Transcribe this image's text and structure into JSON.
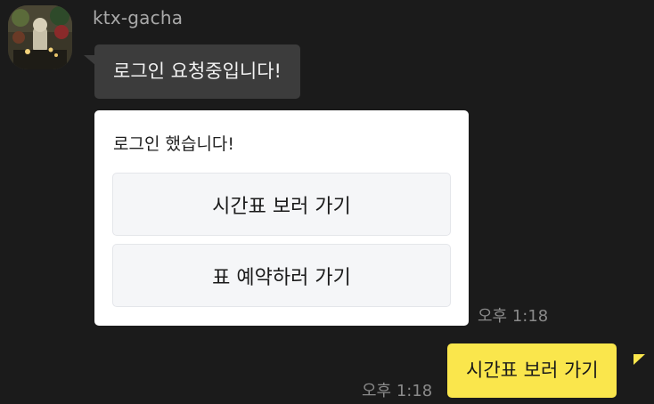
{
  "sender": {
    "name": "ktx-gacha",
    "avatar_icon": "profile-photo-avatar"
  },
  "incoming_message": {
    "text": "로그인 요청중입니다!"
  },
  "card": {
    "text": "로그인 했습니다!",
    "buttons": [
      {
        "label": "시간표 보러 가기"
      },
      {
        "label": "표 예약하러 가기"
      }
    ],
    "time": "오후 1:18"
  },
  "outgoing_message": {
    "text": "시간표 보러 가기",
    "time": "오후 1:18"
  },
  "colors": {
    "background": "#1b1b1b",
    "incoming_bubble": "#3c3c3c",
    "outgoing_bubble": "#fae64c",
    "card": "#ffffff",
    "card_button": "#f5f6f8"
  }
}
